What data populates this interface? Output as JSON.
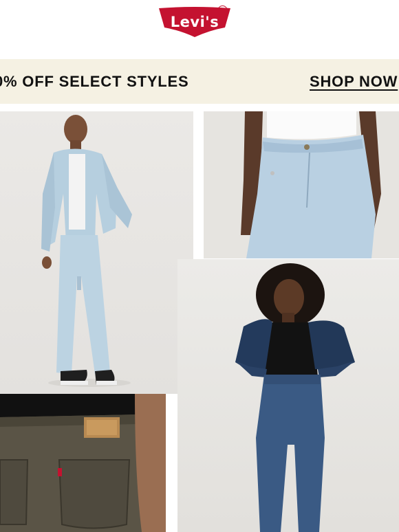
{
  "header": {
    "brand": "Levi's",
    "logo_colors": {
      "red": "#c41230",
      "white": "#ffffff"
    }
  },
  "promo_banner": {
    "text": "0% OFF SELECT STYLES",
    "cta": "SHOP NOW",
    "background": "#f5f1e3"
  },
  "images": [
    {
      "name": "man-light-denim-jacket-jeans"
    },
    {
      "name": "woman-light-jeans-closeup"
    },
    {
      "name": "woman-dark-denim-jacket-jeans"
    },
    {
      "name": "jeans-back-pocket-closeup"
    }
  ]
}
